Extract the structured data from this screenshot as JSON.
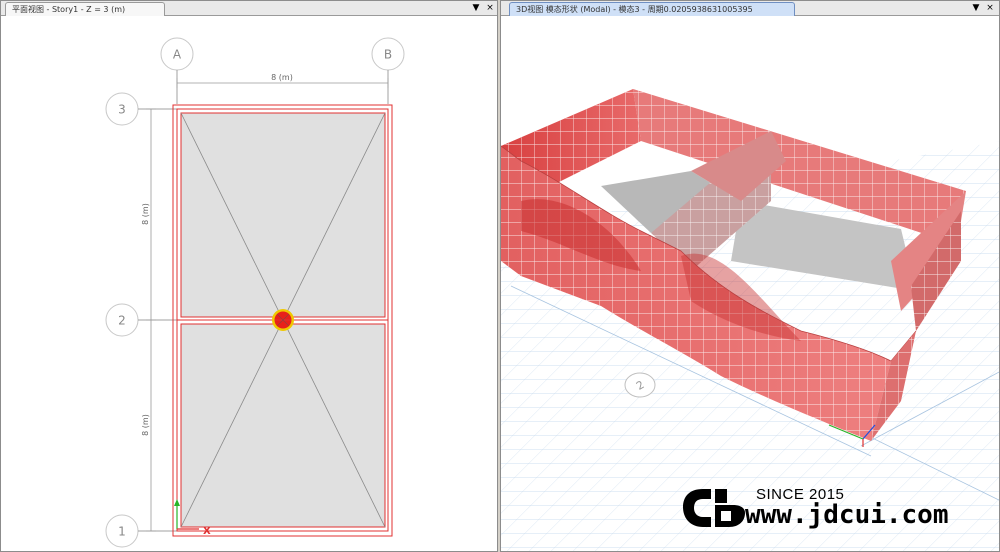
{
  "left_pane": {
    "tab_title": "平面视图 - Story1 - Z = 3 (m)",
    "dropdown_glyph": "▼",
    "close_glyph": "×",
    "grid_columns": [
      "A",
      "B"
    ],
    "grid_rows": [
      "3",
      "2",
      "1"
    ],
    "top_dimension": "8 (m)",
    "upper_dimension": "8 (m)",
    "lower_dimension": "8 (m)",
    "axis_x_label": "X",
    "colors": {
      "slab": "#e0e0e0",
      "beam": "#e03030",
      "column": "#e8201a",
      "column_ring": "#f0c800",
      "grid": "#a0a0a0"
    }
  },
  "right_pane": {
    "tab_title": "3D视图  模态形状 (Modal) - 模态3 - 周期0.0205938631005395",
    "dropdown_glyph": "▼",
    "close_glyph": "×",
    "grid_bubble": "2",
    "colors": {
      "wall": "#e25a5a",
      "mesh": "#ffffff",
      "floor": "#c4c4c4",
      "ground_grid": "#c9dcee"
    }
  },
  "watermark": {
    "since": "SINCE 2015",
    "site": "www.jdcui.com",
    "logo_letters": "CJD"
  }
}
